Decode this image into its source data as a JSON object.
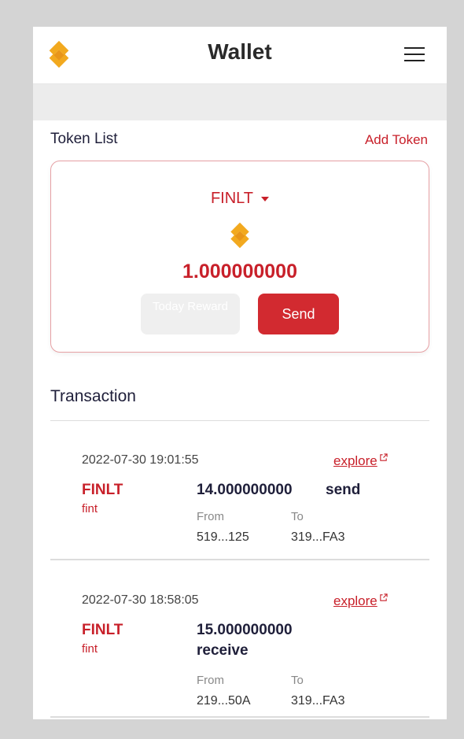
{
  "header": {
    "title": "Wallet",
    "logo_icon": "finlt-logo-icon",
    "menu_icon": "hamburger-menu-icon"
  },
  "token_list": {
    "heading": "Token List",
    "add_token_label": "Add Token"
  },
  "token_card": {
    "selected_token": "FINLT",
    "balance": "1.000000000",
    "today_reward_label": "Today Reward",
    "send_label": "Send"
  },
  "transactions": {
    "heading": "Transaction",
    "items": [
      {
        "date": "2022-07-30 19:01:55",
        "explore_label": "explore",
        "symbol": "FINLT",
        "sub": "fint",
        "amount": "14.000000000",
        "action": "send",
        "from_label": "From",
        "from": "519...125",
        "to_label": "To",
        "to": "319...FA3"
      },
      {
        "date": "2022-07-30 18:58:05",
        "explore_label": "explore",
        "symbol": "FINLT",
        "sub": "fint",
        "amount": "15.000000000",
        "action": "receive",
        "from_label": "From",
        "from": "219...50A",
        "to_label": "To",
        "to": "319...FA3"
      }
    ]
  },
  "colors": {
    "accent": "#c8202a",
    "logo_orange": "#f2a91f",
    "text_dark": "#1f1f3a"
  }
}
